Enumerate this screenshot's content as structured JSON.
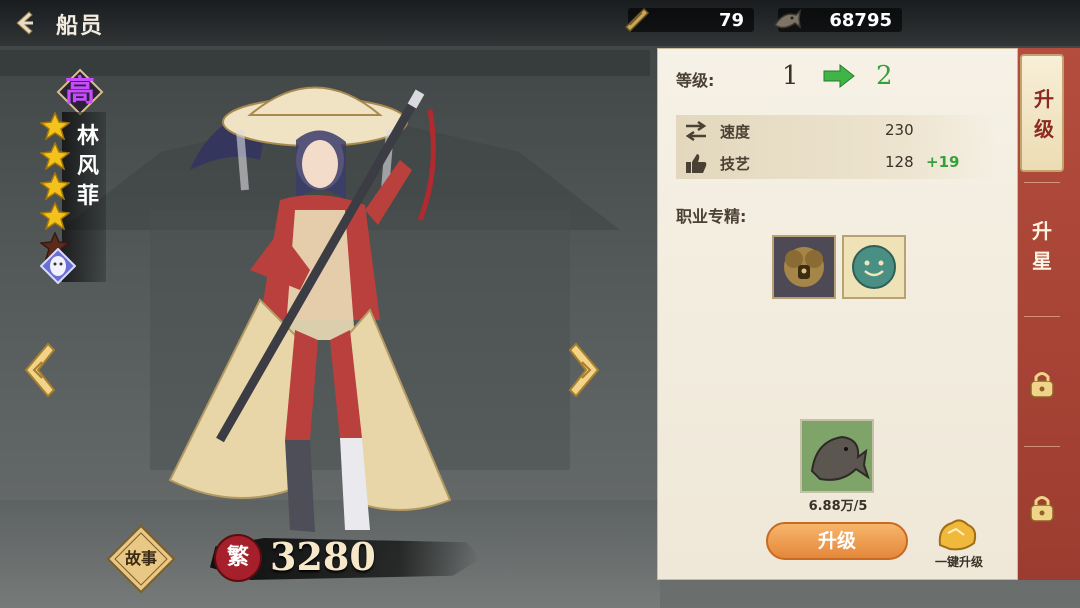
{
  "header": {
    "title": "船员",
    "resources": [
      {
        "icon": "scroll-icon",
        "value": "79"
      },
      {
        "icon": "fish-icon",
        "value": "68795"
      }
    ]
  },
  "hero": {
    "rank": "高",
    "name_chars": [
      "林",
      "风",
      "菲"
    ],
    "stars_filled": 4,
    "stars_total": 5,
    "power_seal": "繁",
    "power": "3280",
    "story_label": "故事"
  },
  "panel": {
    "level_label": "等级:",
    "level_from": "1",
    "level_to": "2",
    "stats": [
      {
        "name": "速度",
        "value": "230",
        "bonus": "",
        "icon": "speed-icon"
      },
      {
        "name": "技艺",
        "value": "128",
        "bonus": "+19",
        "icon": "thumbs-up-icon"
      }
    ],
    "specialty_label": "职业专精:",
    "material_count": "6.88万/5",
    "upgrade_label": "升级",
    "oneclick_label": "一键升级"
  },
  "tabs": {
    "upgrade": "升级",
    "star_up": "升星"
  },
  "colors": {
    "accent_green": "#36a13a",
    "rank_purple": "#c84cff",
    "tab_red": "#a8453a",
    "button_orange": "#e4873a"
  }
}
